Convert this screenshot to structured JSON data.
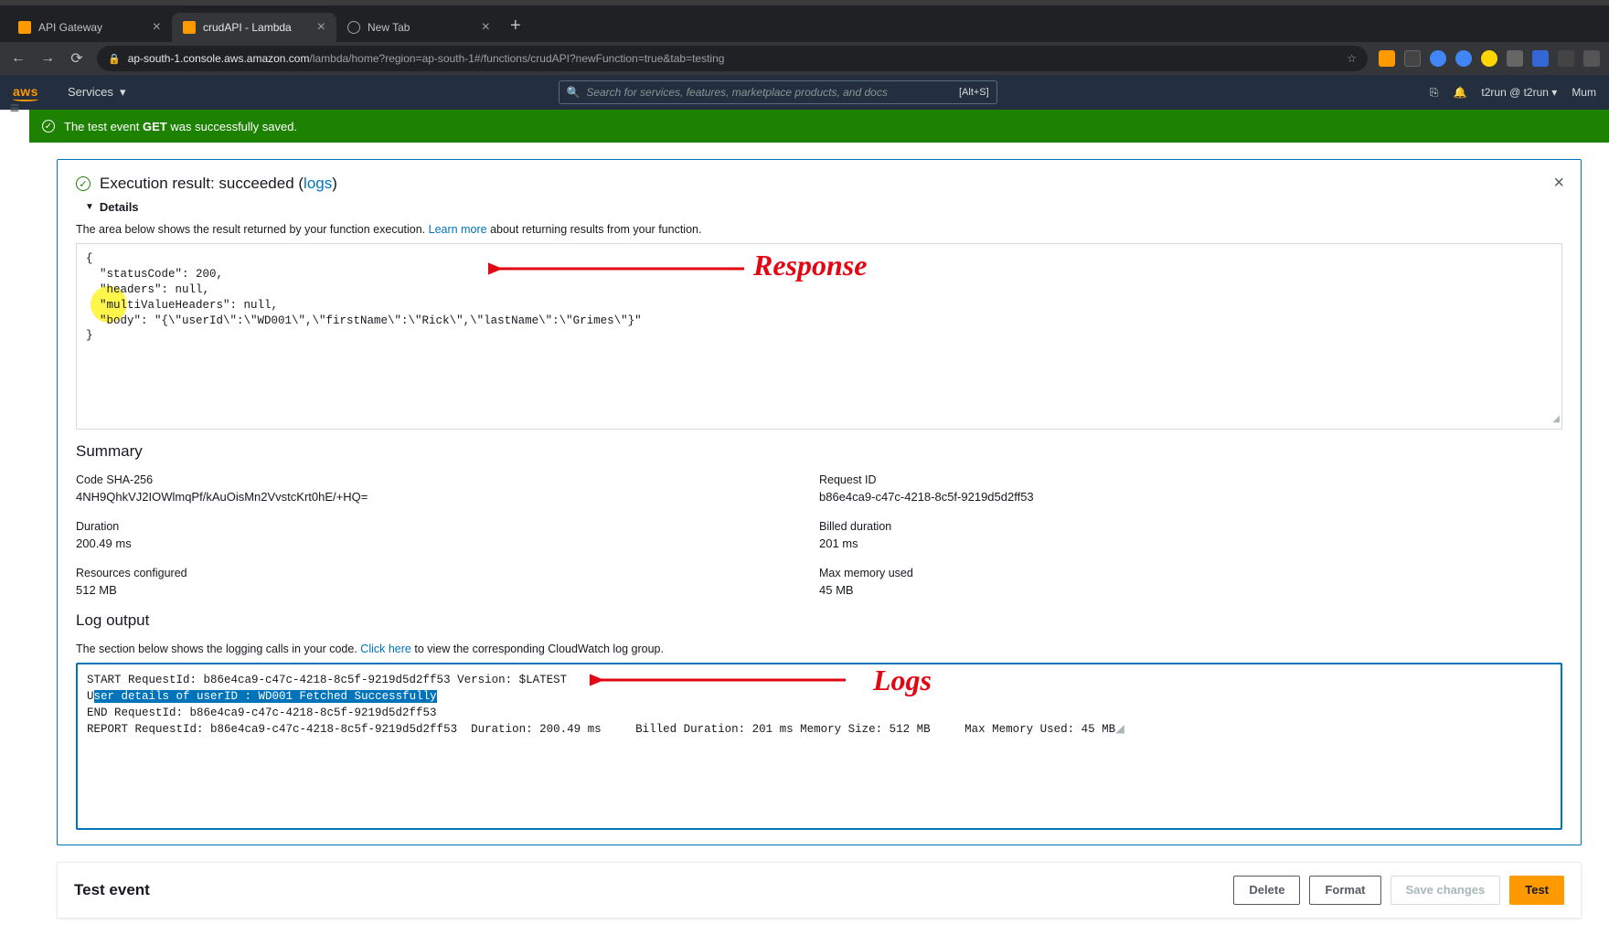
{
  "browser": {
    "tabs": [
      {
        "label": "API Gateway",
        "icon_color": "#ff9900"
      },
      {
        "label": "crudAPI - Lambda",
        "icon_color": "#ff9900"
      },
      {
        "label": "New Tab",
        "icon_color": "#9aa0a6"
      }
    ],
    "url_host": "ap-south-1.console.aws.amazon.com",
    "url_path": "/lambda/home?region=ap-south-1#/functions/crudAPI?newFunction=true&tab=testing"
  },
  "aws_header": {
    "services_label": "Services",
    "search_placeholder": "Search for services, features, marketplace products, and docs",
    "search_shortcut": "[Alt+S]",
    "account": "t2run @ t2run",
    "region": "Mum"
  },
  "banner": {
    "prefix": "The test event",
    "event_name": "GET",
    "suffix": "was successfully saved."
  },
  "result": {
    "title_prefix": "Execution result:",
    "title_status": "succeeded",
    "logs_link": "logs",
    "details_label": "Details",
    "desc_prefix": "The area below shows the result returned by your function execution.",
    "learn_more": "Learn more",
    "desc_suffix": "about returning results from your function.",
    "response_json": "{\n  \"statusCode\": 200,\n  \"headers\": null,\n  \"multiValueHeaders\": null,\n  \"body\": \"{\\\"userId\\\":\\\"WD001\\\",\\\"firstName\\\":\\\"Rick\\\",\\\"lastName\\\":\\\"Grimes\\\"}\"\n}"
  },
  "summary": {
    "heading": "Summary",
    "code_sha_label": "Code SHA-256",
    "code_sha_value": "4NH9QhkVJ2IOWlmqPf/kAuOisMn2VvstcKrt0hE/+HQ=",
    "request_id_label": "Request ID",
    "request_id_value": "b86e4ca9-c47c-4218-8c5f-9219d5d2ff53",
    "duration_label": "Duration",
    "duration_value": "200.49 ms",
    "billed_label": "Billed duration",
    "billed_value": "201 ms",
    "resources_label": "Resources configured",
    "resources_value": "512 MB",
    "memory_label": "Max memory used",
    "memory_value": "45 MB"
  },
  "logs": {
    "heading": "Log output",
    "desc_prefix": "The section below shows the logging calls in your code.",
    "click_here": "Click here",
    "desc_suffix": "to view the corresponding CloudWatch log group.",
    "line1": "START RequestId: b86e4ca9-c47c-4218-8c5f-9219d5d2ff53 Version: $LATEST",
    "line2_prefix": "U",
    "line2_highlight": "ser details of userID : WD001 Fetched Successfully",
    "line3": "END RequestId: b86e4ca9-c47c-4218-8c5f-9219d5d2ff53",
    "line4": "REPORT RequestId: b86e4ca9-c47c-4218-8c5f-9219d5d2ff53  Duration: 200.49 ms     Billed Duration: 201 ms Memory Size: 512 MB     Max Memory Used: 45 MB"
  },
  "annotations": {
    "response_label": "Response",
    "logs_label": "Logs"
  },
  "test_event": {
    "title": "Test event",
    "delete_btn": "Delete",
    "format_btn": "Format",
    "save_btn": "Save changes",
    "test_btn": "Test"
  }
}
